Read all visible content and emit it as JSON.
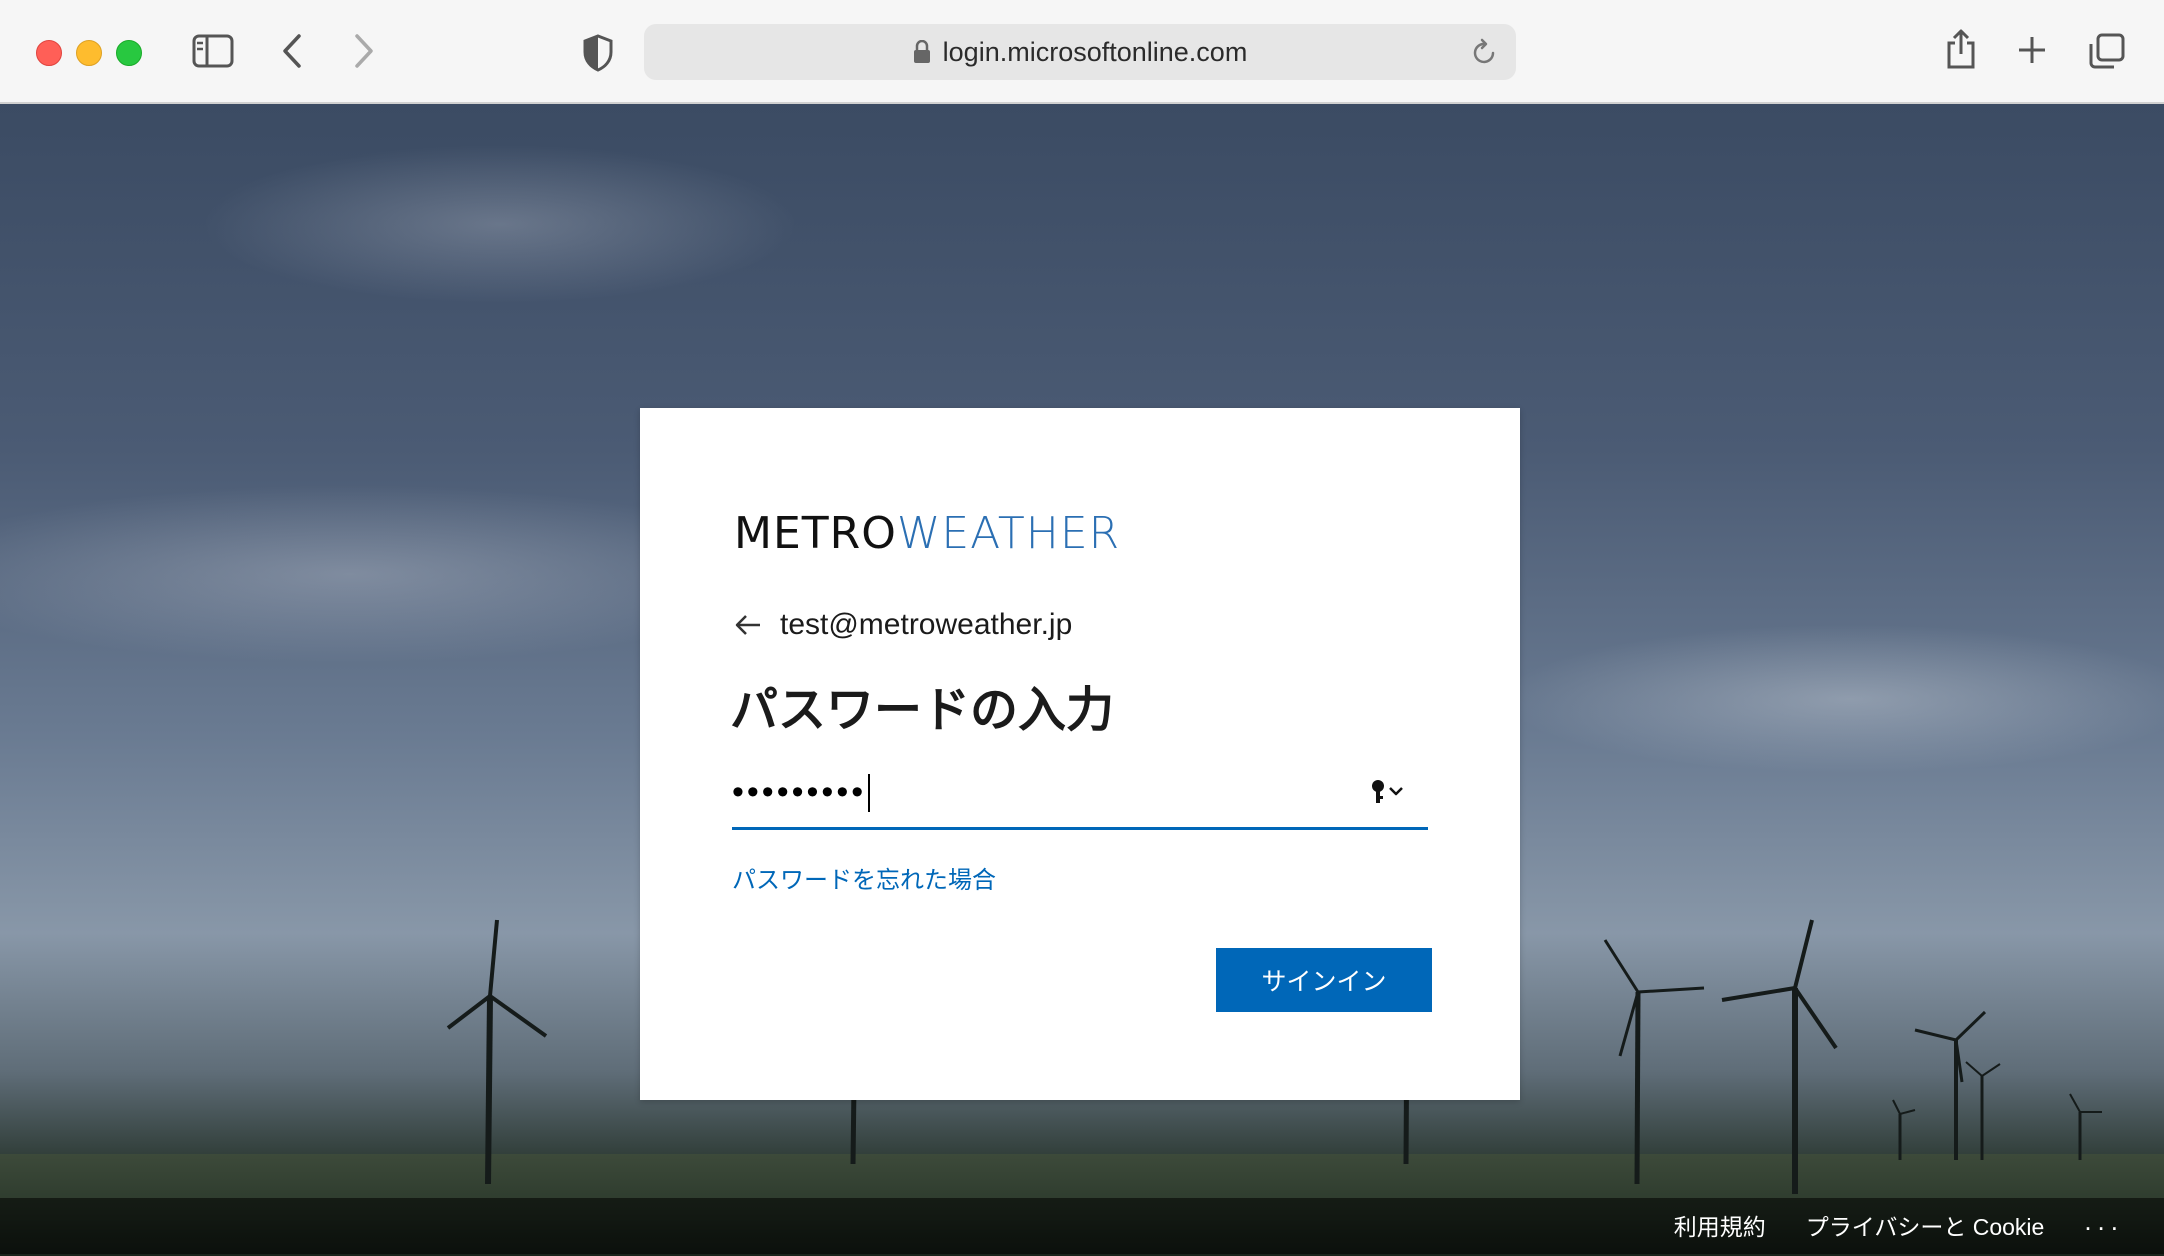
{
  "browser": {
    "url": "login.microsoftonline.com"
  },
  "card": {
    "logo": {
      "metro": "METRO",
      "weather": "WEATHER"
    },
    "identity_email": "test@metroweather.jp",
    "title": "パスワードの入力",
    "password_mask": "•••••••••",
    "forgot_password": "パスワードを忘れた場合",
    "signin_button": "サインイン"
  },
  "footer": {
    "terms": "利用規約",
    "privacy": "プライバシーと Cookie",
    "more": "..."
  },
  "colors": {
    "accent": "#0067b8",
    "logo_weather": "#2b6fb3"
  }
}
